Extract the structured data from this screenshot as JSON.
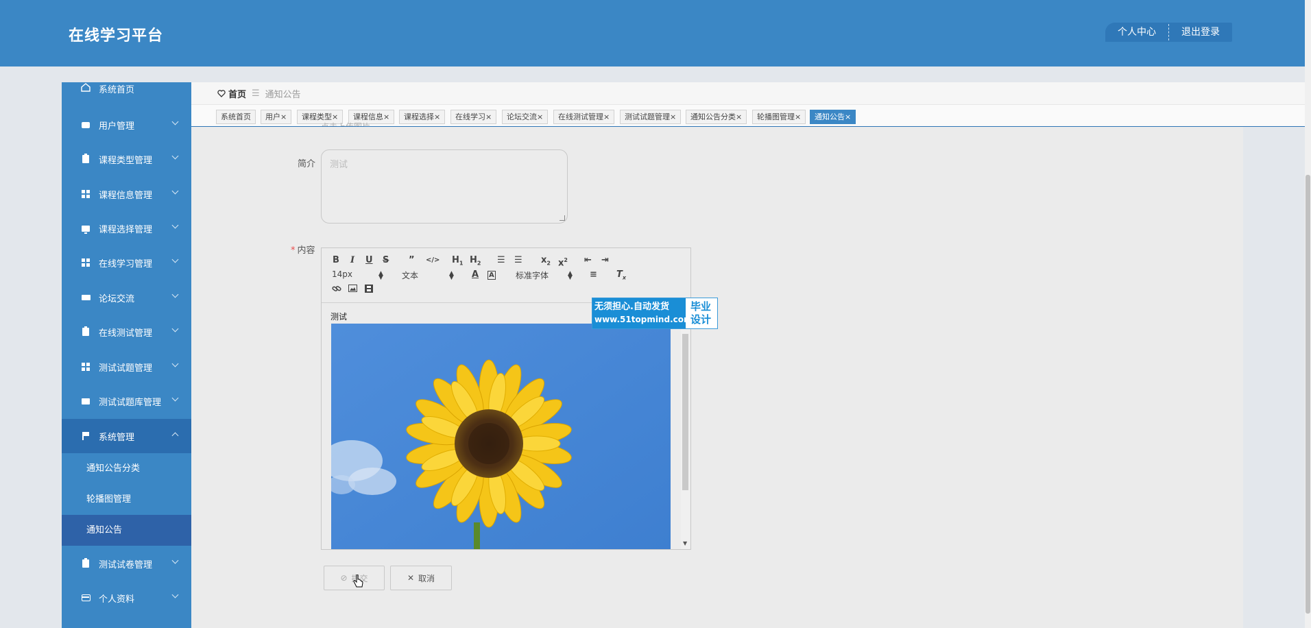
{
  "header": {
    "app_title": "在线学习平台",
    "personal_center": "个人中心",
    "logout": "退出登录"
  },
  "sidebar": {
    "items": [
      {
        "label": "系统首页",
        "icon": "home-icon"
      },
      {
        "label": "用户管理",
        "icon": "chat-icon"
      },
      {
        "label": "课程类型管理",
        "icon": "clipboard-icon"
      },
      {
        "label": "课程信息管理",
        "icon": "grid-icon"
      },
      {
        "label": "课程选择管理",
        "icon": "monitor-icon"
      },
      {
        "label": "在线学习管理",
        "icon": "grid-icon"
      },
      {
        "label": "论坛交流",
        "icon": "ticket-icon"
      },
      {
        "label": "在线测试管理",
        "icon": "clipboard-icon"
      },
      {
        "label": "测试试题管理",
        "icon": "grid-icon"
      },
      {
        "label": "测试试题库管理",
        "icon": "thumb-icon"
      },
      {
        "label": "系统管理",
        "icon": "flag-icon"
      },
      {
        "label": "测试试卷管理",
        "icon": "clipboard-icon"
      },
      {
        "label": "个人资料",
        "icon": "card-icon"
      }
    ],
    "sub_items": [
      {
        "label": "通知公告分类"
      },
      {
        "label": "轮播图管理"
      },
      {
        "label": "通知公告"
      }
    ]
  },
  "breadcrumb": {
    "home": "首页",
    "separator": "☰",
    "current": "通知公告"
  },
  "tabs": [
    {
      "label": "系统首页"
    },
    {
      "label": "用户"
    },
    {
      "label": "课程类型"
    },
    {
      "label": "课程信息"
    },
    {
      "label": "课程选择"
    },
    {
      "label": "在线学习"
    },
    {
      "label": "论坛交流"
    },
    {
      "label": "在线测试管理"
    },
    {
      "label": "测试试题管理"
    },
    {
      "label": "通知公告分类"
    },
    {
      "label": "轮播图管理"
    },
    {
      "label": "通知公告"
    }
  ],
  "tab_close": "×",
  "form": {
    "partial_label": "点击上传图片",
    "intro_label": "简介",
    "intro_value": "测试",
    "content_required": "*",
    "content_label": "内容",
    "editor": {
      "font_size": "14px",
      "text_type": "文本",
      "font_family": "标准字体",
      "body_text": "测试",
      "image_desc": "sunflower"
    },
    "submit": "提交",
    "cancel": "取消"
  },
  "watermark": {
    "line1": "无须担心.自动发货",
    "line2": "www.51topmind.com",
    "right1": "毕业",
    "right2": "设计"
  },
  "colors": {
    "primary": "#3b87c5",
    "active_sub": "#2e62a8",
    "content_bg": "#ebebeb"
  }
}
